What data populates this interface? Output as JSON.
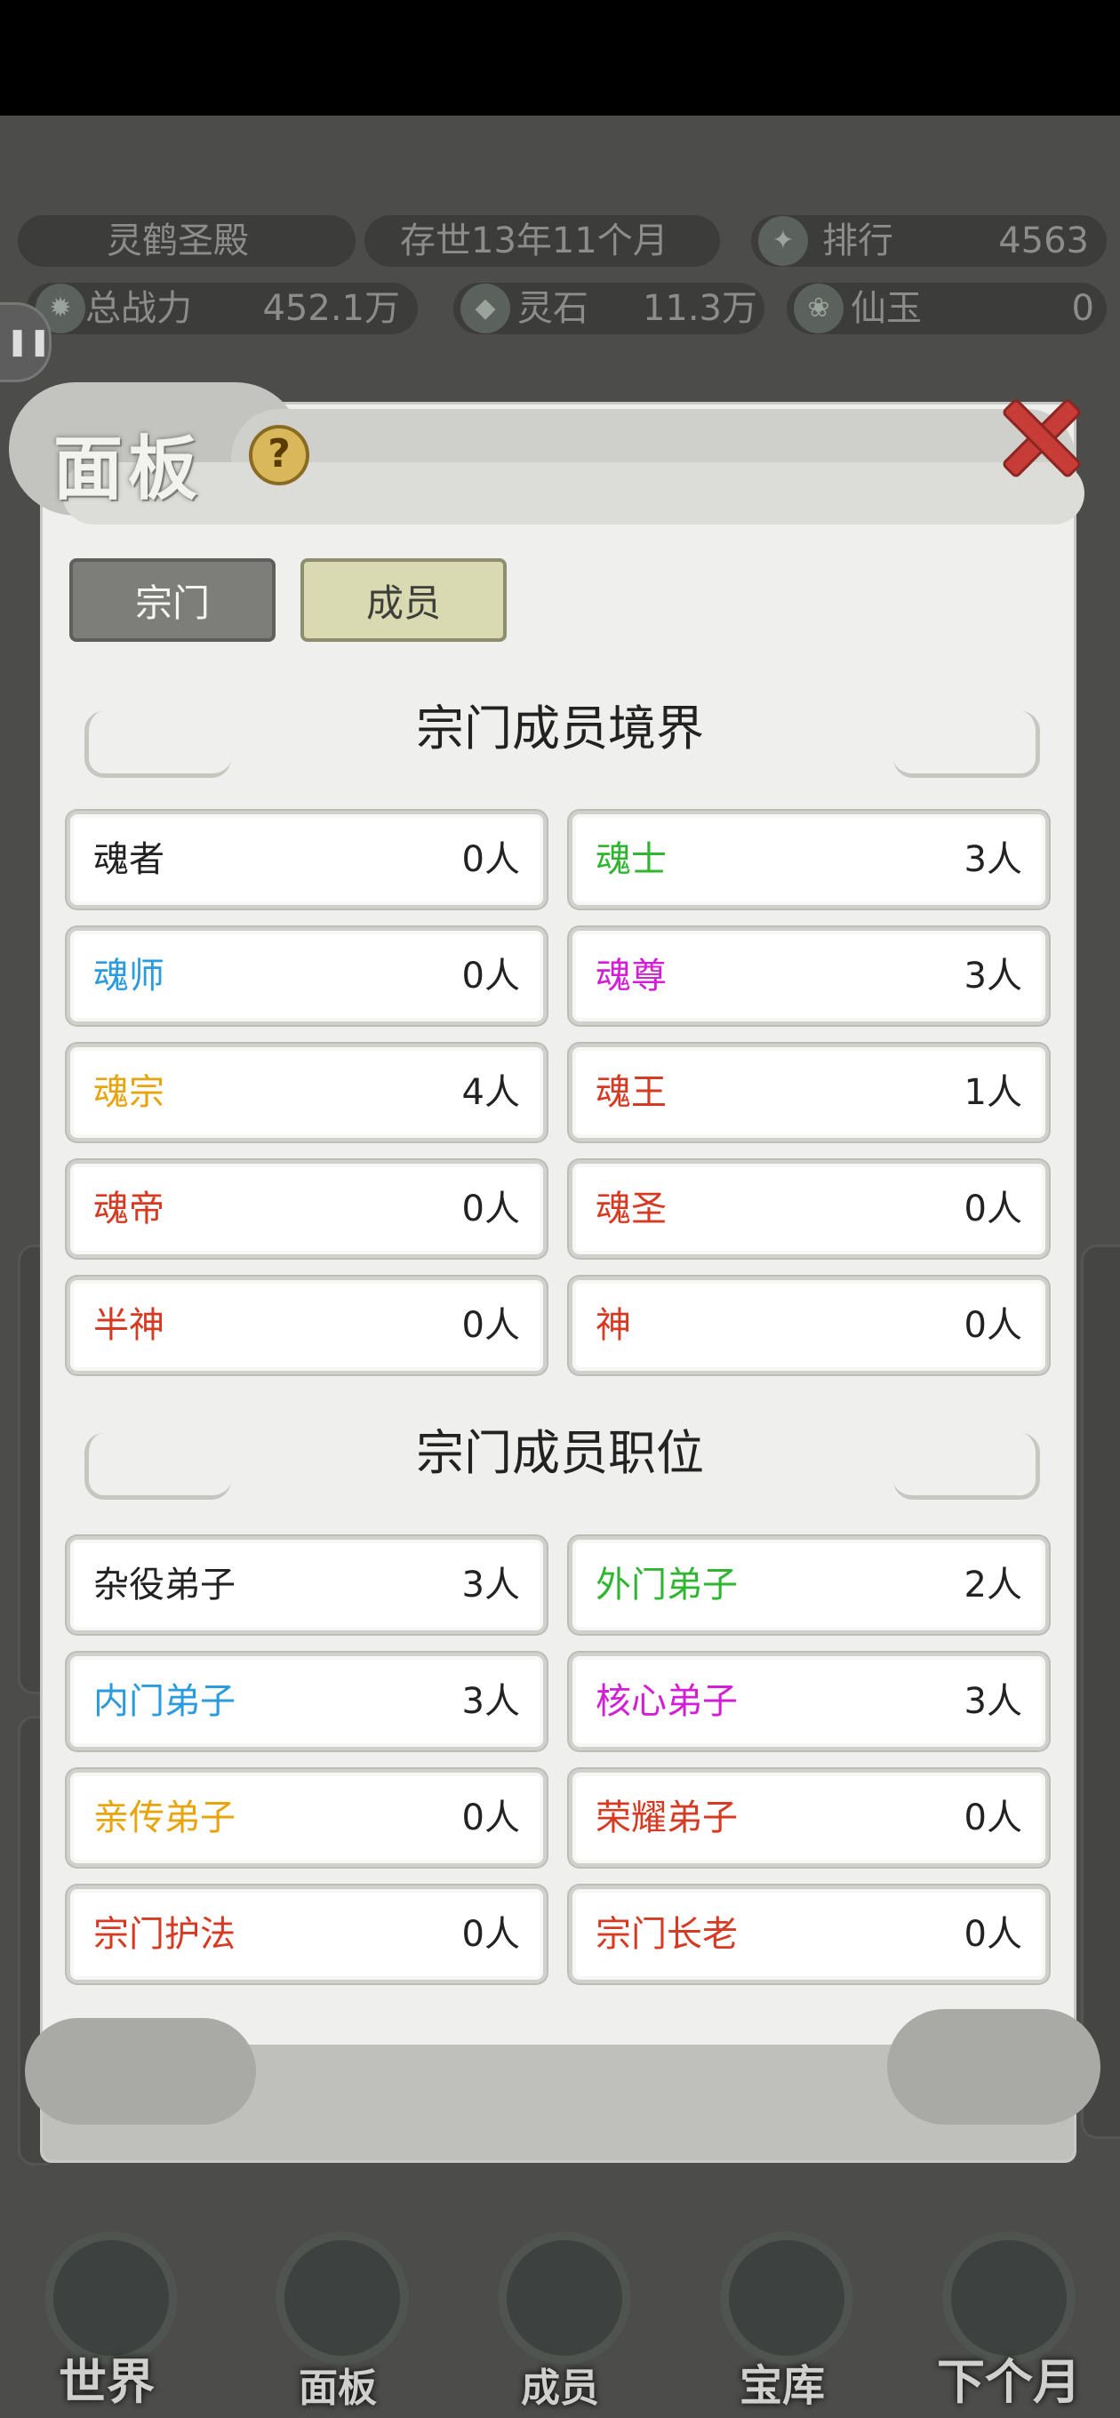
{
  "topbar": {
    "sect_name": "灵鹤圣殿",
    "age": "存世13年11个月",
    "rank_label": "排行",
    "rank_value": "4563",
    "power_label": "总战力",
    "power_value": "452.1万",
    "spirit_stone_label": "灵石",
    "spirit_stone_value": "11.3万",
    "jade_label": "仙玉",
    "jade_value": "0"
  },
  "panel": {
    "title": "面板",
    "help_glyph": "?",
    "tabs": [
      {
        "label": "宗门",
        "active": false
      },
      {
        "label": "成员",
        "active": true
      }
    ]
  },
  "realm_section": {
    "title": "宗门成员境界",
    "items": [
      {
        "name": "魂者",
        "count": "0人",
        "color": "#222222"
      },
      {
        "name": "魂士",
        "count": "3人",
        "color": "#2fb52f"
      },
      {
        "name": "魂师",
        "count": "0人",
        "color": "#2a9bdc"
      },
      {
        "name": "魂尊",
        "count": "3人",
        "color": "#d21fd6"
      },
      {
        "name": "魂宗",
        "count": "4人",
        "color": "#e8a40c"
      },
      {
        "name": "魂王",
        "count": "1人",
        "color": "#d63a22"
      },
      {
        "name": "魂帝",
        "count": "0人",
        "color": "#d63a22"
      },
      {
        "name": "魂圣",
        "count": "0人",
        "color": "#d63a22"
      },
      {
        "name": "半神",
        "count": "0人",
        "color": "#d63a22"
      },
      {
        "name": "神",
        "count": "0人",
        "color": "#d63a22"
      }
    ]
  },
  "position_section": {
    "title": "宗门成员职位",
    "items": [
      {
        "name": "杂役弟子",
        "count": "3人",
        "color": "#222222"
      },
      {
        "name": "外门弟子",
        "count": "2人",
        "color": "#2fb52f"
      },
      {
        "name": "内门弟子",
        "count": "3人",
        "color": "#2a9bdc"
      },
      {
        "name": "核心弟子",
        "count": "3人",
        "color": "#d21fd6"
      },
      {
        "name": "亲传弟子",
        "count": "0人",
        "color": "#e8a40c"
      },
      {
        "name": "荣耀弟子",
        "count": "0人",
        "color": "#d63a22"
      },
      {
        "name": "宗门护法",
        "count": "0人",
        "color": "#d63a22"
      },
      {
        "name": "宗门长老",
        "count": "0人",
        "color": "#d63a22"
      }
    ]
  },
  "bottom_nav": [
    {
      "label": "世界"
    },
    {
      "label": "面板"
    },
    {
      "label": "成员"
    },
    {
      "label": "宝库"
    },
    {
      "label": "下个月"
    }
  ]
}
